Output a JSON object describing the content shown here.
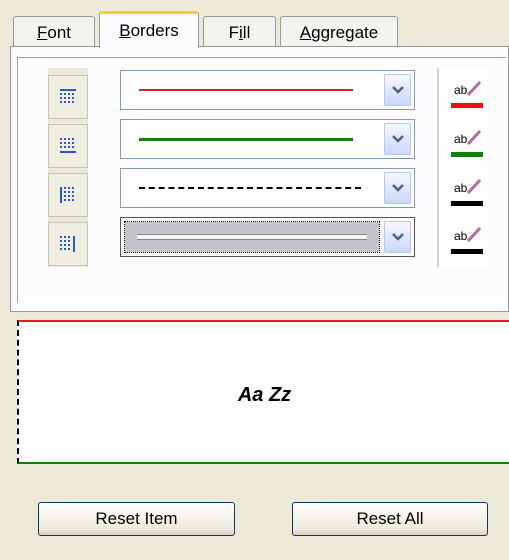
{
  "tabs": [
    {
      "label": "Font",
      "accel": "F",
      "rest": "ont",
      "active": false
    },
    {
      "label": "Borders",
      "accel": "B",
      "rest": "orders",
      "active": true
    },
    {
      "label": "Fill",
      "accel": "i",
      "pre": "F",
      "rest": "ll",
      "active": false
    },
    {
      "label": "Aggregate",
      "accel": "A",
      "rest": "ggregate",
      "active": false
    }
  ],
  "border_rows": [
    {
      "side_icon": "border-top-icon",
      "line_style": "solid",
      "line_color": "#e02020",
      "swatch_color": "#e81010"
    },
    {
      "side_icon": "border-bottom-icon",
      "line_style": "solid",
      "line_color": "#108010",
      "swatch_color": "#108010"
    },
    {
      "side_icon": "border-left-icon",
      "line_style": "dashed",
      "line_color": "#000000",
      "swatch_color": "#000000"
    },
    {
      "side_icon": "border-right-icon",
      "line_style": "none-selected",
      "line_color": "#c4c4cc",
      "swatch_color": "#000000"
    }
  ],
  "preview": {
    "text": "Aa Zz"
  },
  "buttons": {
    "reset_item": "Reset Item",
    "reset_all": "Reset All"
  },
  "colors": {
    "accent_tab": "#ffc83c",
    "panel_bg": "#ece9d8"
  }
}
